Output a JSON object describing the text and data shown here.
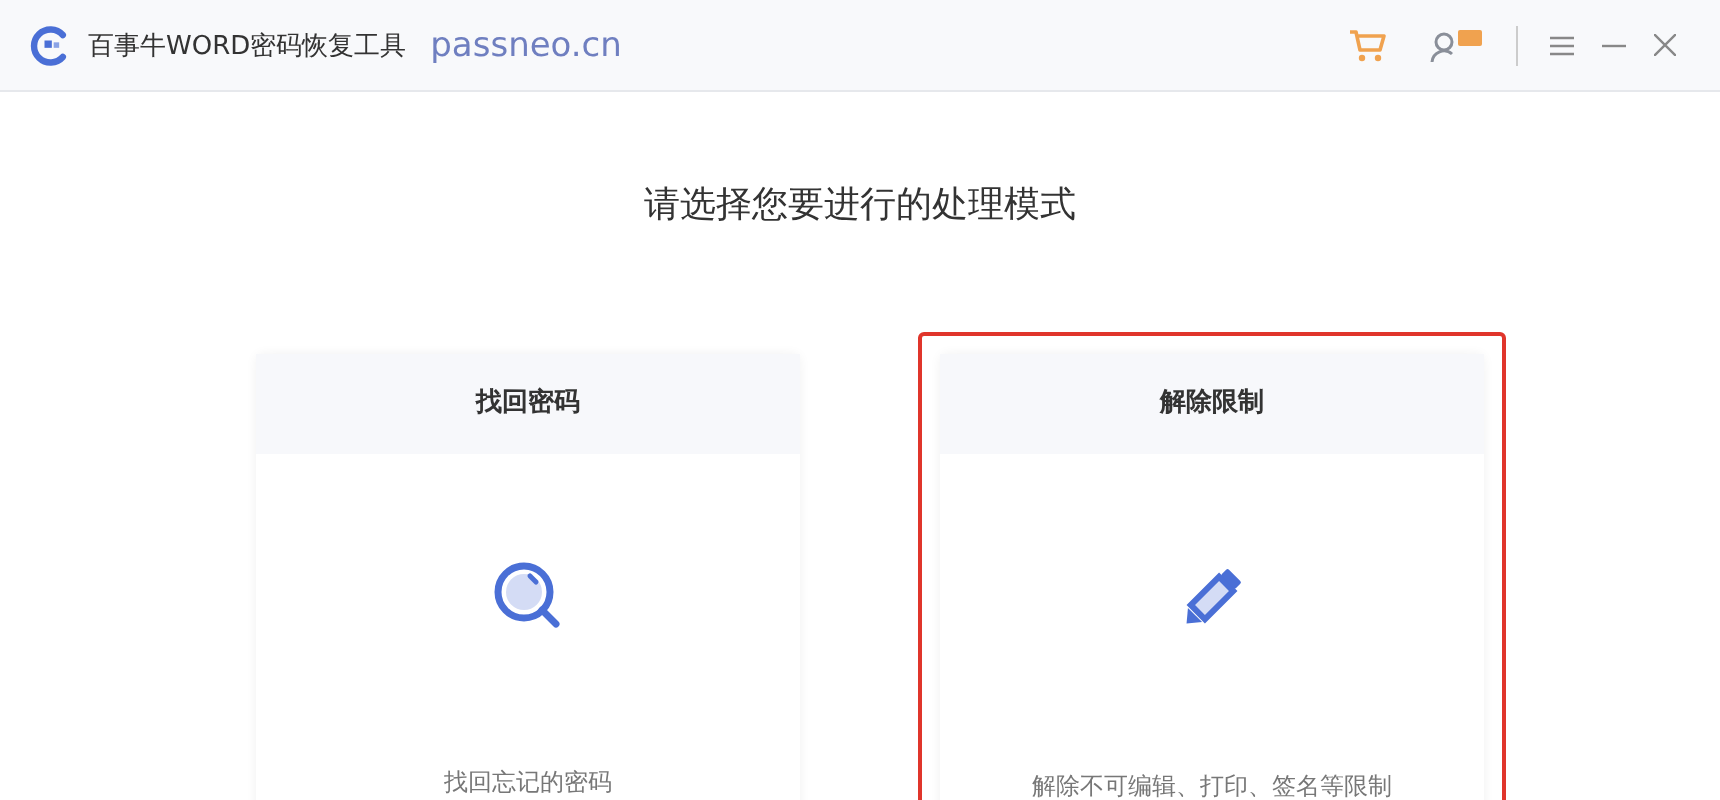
{
  "window": {
    "title": "百事牛WORD密码恢复工具",
    "site": "passneo.cn"
  },
  "heading": "请选择您要进行的处理模式",
  "modes": [
    {
      "title": "找回密码",
      "description": "找回忘记的密码",
      "selected": false
    },
    {
      "title": "解除限制",
      "description": "解除不可编辑、打印、签名等限制",
      "selected": true
    }
  ]
}
